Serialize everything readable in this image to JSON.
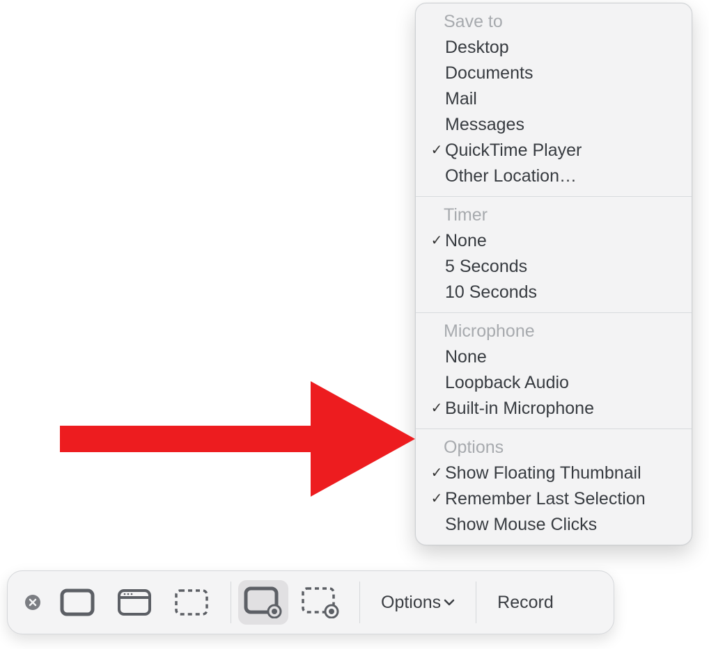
{
  "menu": {
    "groups": [
      {
        "header": "Save to",
        "items": [
          {
            "label": "Desktop",
            "checked": false
          },
          {
            "label": "Documents",
            "checked": false
          },
          {
            "label": "Mail",
            "checked": false
          },
          {
            "label": "Messages",
            "checked": false
          },
          {
            "label": "QuickTime Player",
            "checked": true
          },
          {
            "label": "Other Location…",
            "checked": false
          }
        ]
      },
      {
        "header": "Timer",
        "items": [
          {
            "label": "None",
            "checked": true
          },
          {
            "label": "5 Seconds",
            "checked": false
          },
          {
            "label": "10 Seconds",
            "checked": false
          }
        ]
      },
      {
        "header": "Microphone",
        "items": [
          {
            "label": "None",
            "checked": false
          },
          {
            "label": "Loopback Audio",
            "checked": false
          },
          {
            "label": "Built-in Microphone",
            "checked": true
          }
        ]
      },
      {
        "header": "Options",
        "items": [
          {
            "label": "Show Floating Thumbnail",
            "checked": true
          },
          {
            "label": "Remember Last Selection",
            "checked": true
          },
          {
            "label": "Show Mouse Clicks",
            "checked": false
          }
        ]
      }
    ]
  },
  "toolbar": {
    "options_label": "Options",
    "record_label": "Record"
  }
}
